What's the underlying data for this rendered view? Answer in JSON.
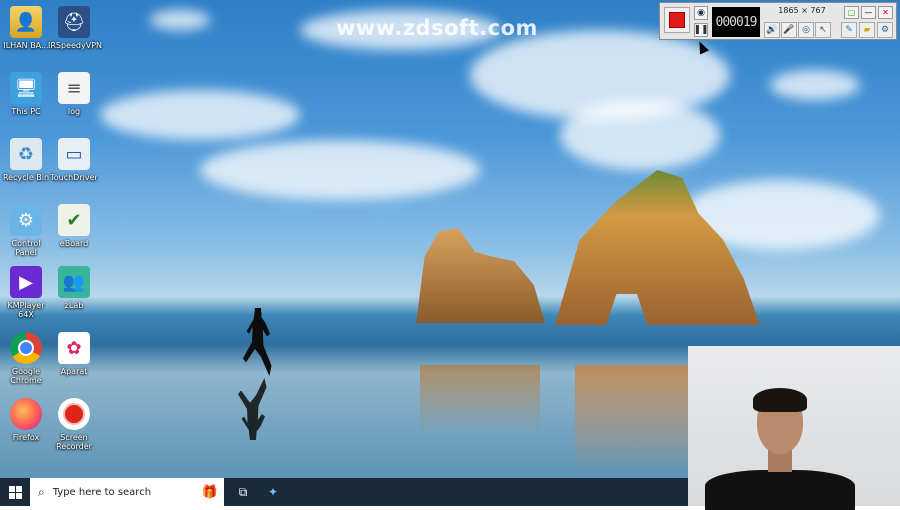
{
  "watermark": "www.zdsoft.com",
  "desktop_icons": [
    {
      "label": "ILHAN BA...",
      "icon": "user-folder-icon"
    },
    {
      "label": "IRSpeedyVPN",
      "icon": "vpn-icon"
    },
    {
      "label": "This PC",
      "icon": "computer-icon"
    },
    {
      "label": "log",
      "icon": "text-file-icon"
    },
    {
      "label": "Recycle Bin",
      "icon": "recycle-bin-icon"
    },
    {
      "label": "TouchDriver",
      "icon": "monitor-icon"
    },
    {
      "label": "Control Panel",
      "icon": "control-panel-icon"
    },
    {
      "label": "eBoard",
      "icon": "eboard-icon"
    },
    {
      "label": "KMPlayer 64X",
      "icon": "kmplayer-icon"
    },
    {
      "label": "zLab",
      "icon": "zlab-icon"
    },
    {
      "label": "Google Chrome",
      "icon": "chrome-icon"
    },
    {
      "label": "Aparat",
      "icon": "aparat-icon"
    },
    {
      "label": "Firefox",
      "icon": "firefox-icon"
    },
    {
      "label": "Screen Recorder",
      "icon": "screen-recorder-icon"
    }
  ],
  "taskbar": {
    "search_placeholder": "Type here to search"
  },
  "recorder": {
    "timer": "000019",
    "resolution": "1865 × 767"
  }
}
